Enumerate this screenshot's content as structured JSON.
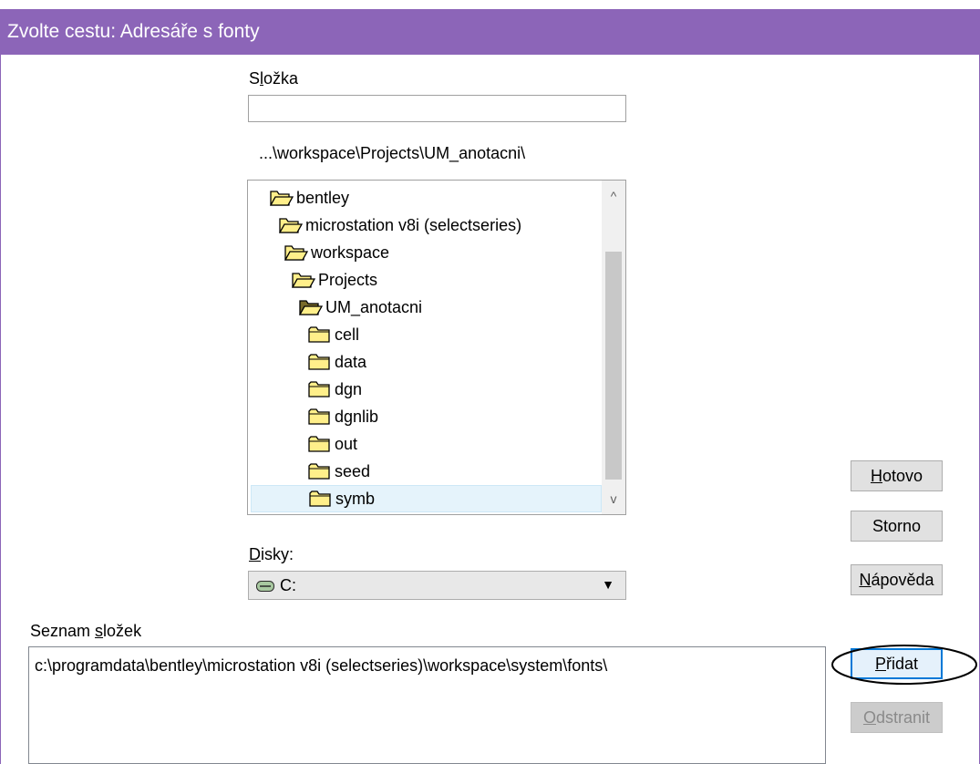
{
  "window": {
    "title": "Zvolte cestu:  Adresáře s fonty"
  },
  "folder_field": {
    "label_prefix": "S",
    "label_mnemonic": "l",
    "label_suffix": "ožka",
    "value": ""
  },
  "current_path": "...\\workspace\\Projects\\UM_anotacni\\",
  "tree": {
    "items": [
      {
        "label": "bentley",
        "state": "open"
      },
      {
        "label": "microstation v8i (selectseries)",
        "state": "open"
      },
      {
        "label": "workspace",
        "state": "open"
      },
      {
        "label": "Projects",
        "state": "open"
      },
      {
        "label": "UM_anotacni",
        "state": "open-current"
      },
      {
        "label": "cell",
        "state": "closed"
      },
      {
        "label": "data",
        "state": "closed"
      },
      {
        "label": "dgn",
        "state": "closed"
      },
      {
        "label": "dgnlib",
        "state": "closed"
      },
      {
        "label": "out",
        "state": "closed"
      },
      {
        "label": "seed",
        "state": "closed"
      },
      {
        "label": "symb",
        "state": "closed",
        "selected": true
      }
    ],
    "scroll_up": "^",
    "scroll_down": "v"
  },
  "disks": {
    "label_mnemonic": "D",
    "label_rest": "isky:",
    "value": "C:",
    "icon": "drive-icon",
    "arrow": "▼"
  },
  "folder_list": {
    "label_prefix": "Seznam ",
    "label_mnemonic": "s",
    "label_suffix": "ložek",
    "items": [
      "c:\\programdata\\bentley\\microstation v8i (selectseries)\\workspace\\system\\fonts\\"
    ]
  },
  "buttons": {
    "done": {
      "mnemonic": "H",
      "rest": "otovo"
    },
    "cancel": {
      "label": "Storno"
    },
    "help": {
      "mnemonic": "N",
      "rest": "ápověda"
    },
    "add": {
      "mnemonic": "P",
      "rest": "řidat"
    },
    "remove": {
      "mnemonic": "O",
      "rest": "dstranit"
    }
  },
  "colors": {
    "titlebar": "#8c65b8",
    "folder_yellow": "#ffef8a",
    "folder_outline": "#000000",
    "selection": "#e5f3fb",
    "annotation_ellipse": "#000000"
  }
}
